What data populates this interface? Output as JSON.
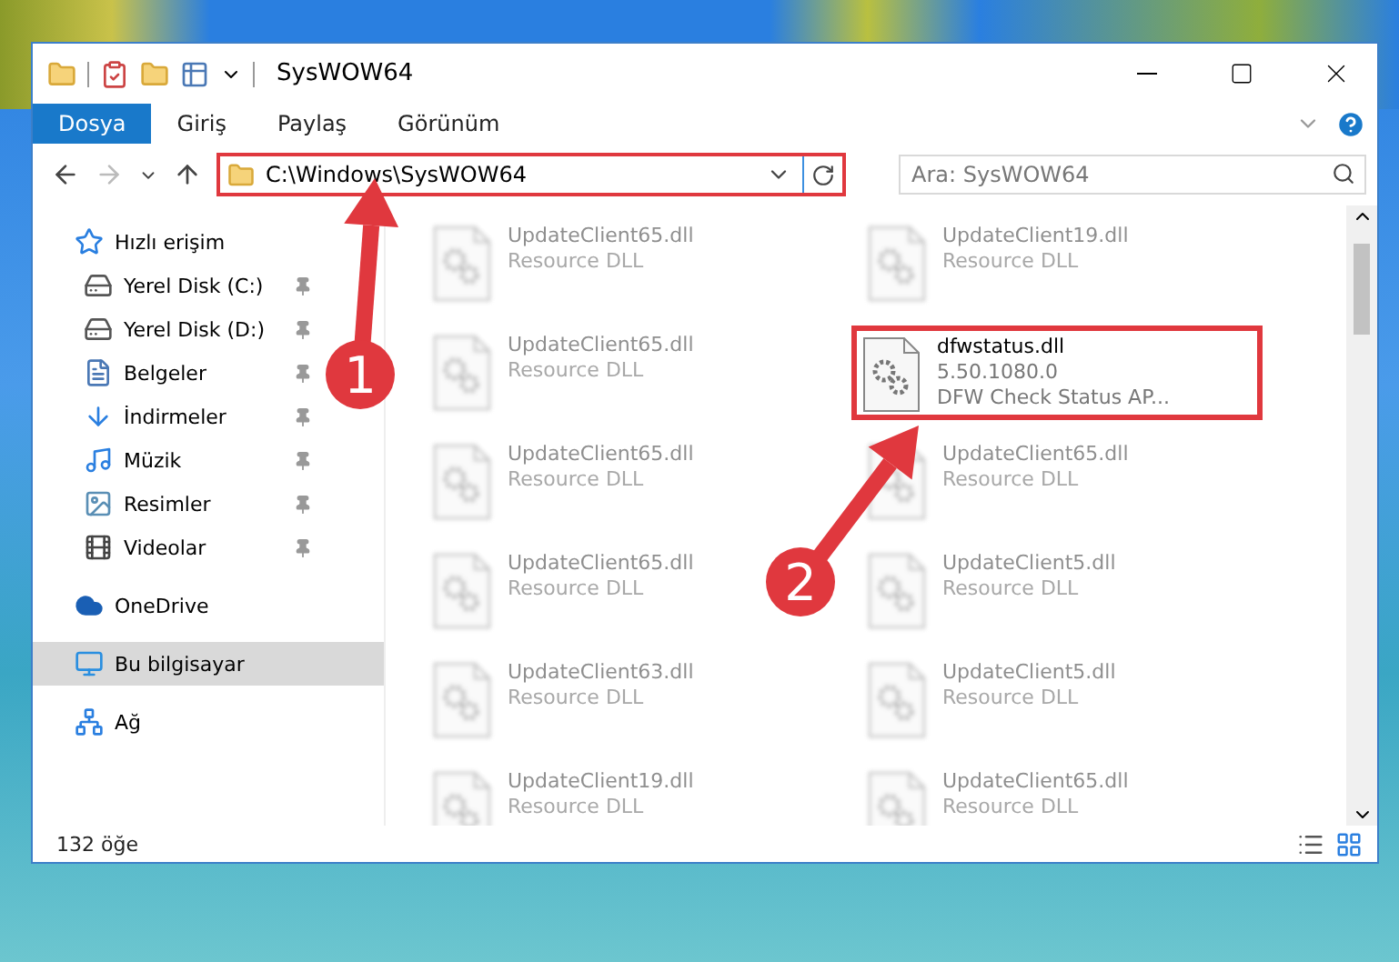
{
  "window": {
    "title": "SysWOW64"
  },
  "ribbon": {
    "tabs": [
      {
        "label": "Dosya",
        "selected": true
      },
      {
        "label": "Giriş",
        "selected": false
      },
      {
        "label": "Paylaş",
        "selected": false
      },
      {
        "label": "Görünüm",
        "selected": false
      }
    ]
  },
  "address_bar": {
    "path": "C:\\Windows\\SysWOW64",
    "highlighted": true
  },
  "search": {
    "placeholder": "Ara: SysWOW64"
  },
  "sidebar": {
    "items": [
      {
        "label": "Hızlı erişim",
        "selected": false,
        "children": [
          {
            "label": "Yerel Disk (C:)",
            "pinned": true
          },
          {
            "label": "Yerel Disk (D:)",
            "pinned": true
          },
          {
            "label": "Belgeler",
            "pinned": true
          },
          {
            "label": "İndirmeler",
            "pinned": true
          },
          {
            "label": "Müzik",
            "pinned": true
          },
          {
            "label": "Resimler",
            "pinned": true
          },
          {
            "label": "Videolar",
            "pinned": true
          }
        ]
      },
      {
        "label": "OneDrive",
        "selected": false
      },
      {
        "label": "Bu bilgisayar",
        "selected": true
      },
      {
        "label": "Ağ",
        "selected": false
      }
    ]
  },
  "files": [
    {
      "name": "UpdateClient65.dll",
      "lines": [
        "Resource DLL"
      ],
      "highlighted": false
    },
    {
      "name": "UpdateClient19.dll",
      "lines": [
        "Resource DLL"
      ],
      "highlighted": false
    },
    {
      "name": "UpdateClient65.dll",
      "lines": [
        "Resource DLL"
      ],
      "highlighted": false
    },
    {
      "name": "dfwstatus.dll",
      "lines": [
        "5.50.1080.0",
        "DFW Check Status AP..."
      ],
      "highlighted": true
    },
    {
      "name": "UpdateClient65.dll",
      "lines": [
        "Resource DLL"
      ],
      "highlighted": false
    },
    {
      "name": "UpdateClient65.dll",
      "lines": [
        "Resource DLL"
      ],
      "highlighted": false
    },
    {
      "name": "UpdateClient65.dll",
      "lines": [
        "Resource DLL"
      ],
      "highlighted": false
    },
    {
      "name": "UpdateClient5.dll",
      "lines": [
        "Resource DLL"
      ],
      "highlighted": false
    },
    {
      "name": "UpdateClient63.dll",
      "lines": [
        "Resource DLL"
      ],
      "highlighted": false
    },
    {
      "name": "UpdateClient5.dll",
      "lines": [
        "Resource DLL"
      ],
      "highlighted": false
    },
    {
      "name": "UpdateClient19.dll",
      "lines": [
        "Resource DLL"
      ],
      "highlighted": false
    },
    {
      "name": "UpdateClient65.dll",
      "lines": [
        "Resource DLL"
      ],
      "highlighted": false
    }
  ],
  "status_bar": {
    "count": "132 öğe"
  },
  "annotations": [
    {
      "label": "1"
    },
    {
      "label": "2"
    }
  ]
}
